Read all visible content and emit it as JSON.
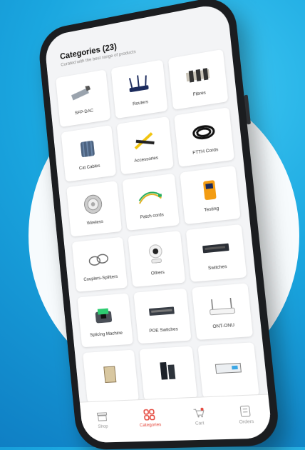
{
  "header": {
    "title": "Categories (23)",
    "subtitle": "Curated with the best range of products"
  },
  "categories": [
    {
      "label": "SFP-DAC",
      "icon": "sfp-module-icon"
    },
    {
      "label": "Routers",
      "icon": "router-icon"
    },
    {
      "label": "Fibres",
      "icon": "fibre-spool-icon"
    },
    {
      "label": "Cat Cables",
      "icon": "cable-drum-icon"
    },
    {
      "label": "Accessories",
      "icon": "cable-stripper-icon"
    },
    {
      "label": "FTTH Cords",
      "icon": "cable-coil-icon"
    },
    {
      "label": "Wireless",
      "icon": "wireless-dish-icon"
    },
    {
      "label": "Patch cords",
      "icon": "patch-cord-icon"
    },
    {
      "label": "Testing",
      "icon": "power-meter-icon"
    },
    {
      "label": "Couplers-Splitters",
      "icon": "splitter-icon"
    },
    {
      "label": "Others",
      "icon": "camera-icon"
    },
    {
      "label": "Switches",
      "icon": "switch-icon"
    },
    {
      "label": "Splicing Machine",
      "icon": "splicer-icon"
    },
    {
      "label": "POE Switches",
      "icon": "poe-switch-icon"
    },
    {
      "label": "ONT-ONU",
      "icon": "ont-icon"
    },
    {
      "label": "",
      "icon": "box-icon"
    },
    {
      "label": "",
      "icon": "rack-icon"
    },
    {
      "label": "",
      "icon": "olt-icon"
    }
  ],
  "nav": [
    {
      "label": "Shop",
      "icon": "shop-icon",
      "active": false
    },
    {
      "label": "Categories",
      "icon": "categories-icon",
      "active": true
    },
    {
      "label": "Cart",
      "icon": "cart-icon",
      "active": false
    },
    {
      "label": "Orders",
      "icon": "orders-icon",
      "active": false
    }
  ],
  "colors": {
    "accent": "#e4463b",
    "background": "#1aa6df"
  }
}
